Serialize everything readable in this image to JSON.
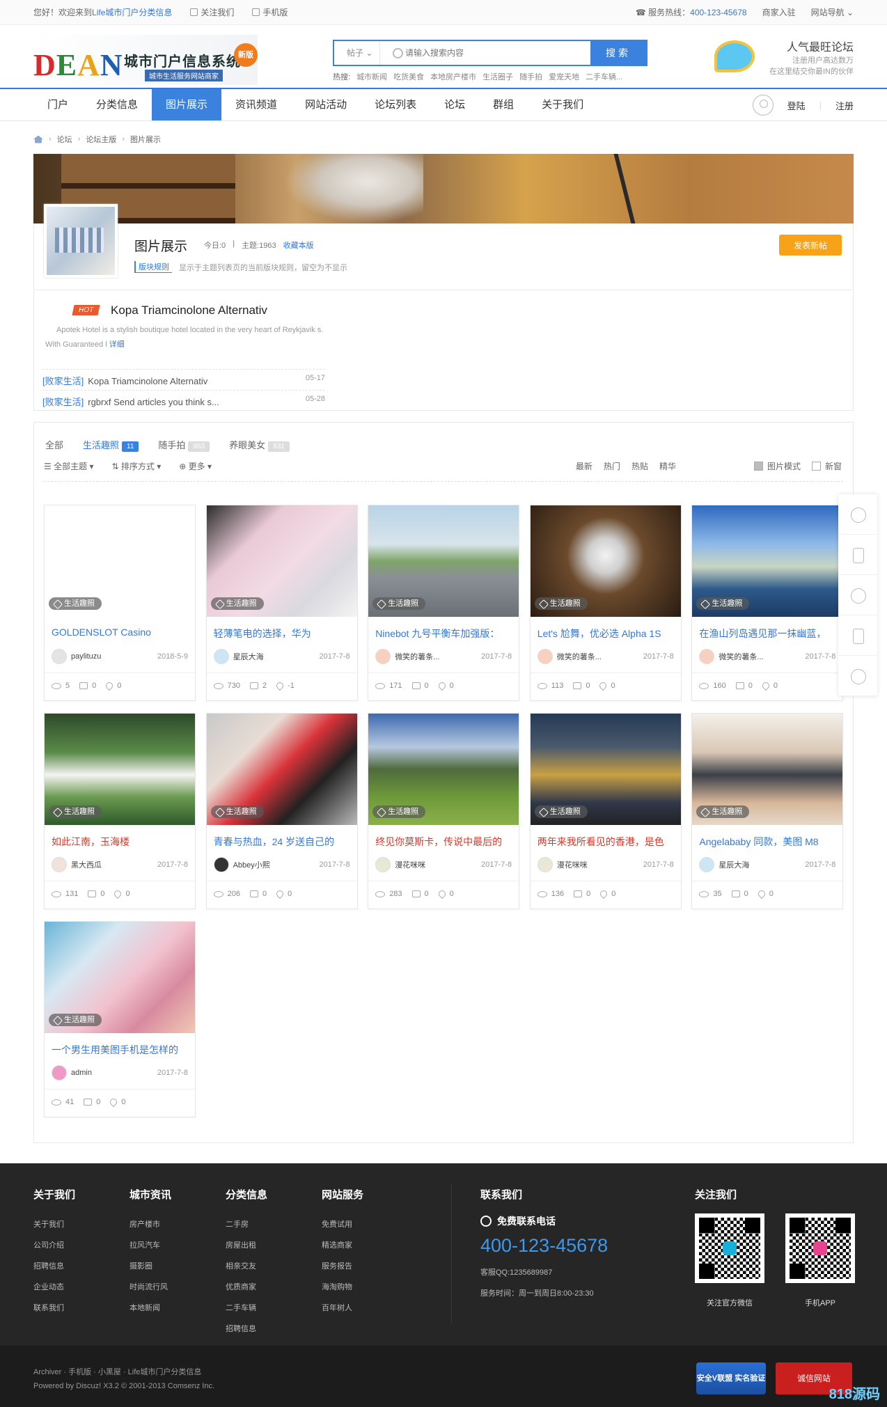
{
  "topbar": {
    "welcome_prefix": "您好！欢迎来到",
    "welcome_site": "Life城市门户分类信息",
    "follow": "关注我们",
    "mobile": "手机版",
    "hotline_label": "服务热线：",
    "hotline": "400-123-45678",
    "merchant": "商家入驻",
    "site_nav": "网站导航"
  },
  "logo": {
    "letters": [
      "D",
      "E",
      "A",
      "N"
    ],
    "title": "城市门户信息系统",
    "subtitle": "城市生活服务网站商家",
    "badge": "新版"
  },
  "search": {
    "scope": "帖子",
    "placeholder": "请输入搜索内容",
    "button": "搜索",
    "hot_label": "热搜:",
    "hot_words": [
      "城市新闻",
      "吃货美食",
      "本地房产楼市",
      "生活圈子",
      "随手拍",
      "爱宠天地",
      "二手车辆..."
    ]
  },
  "promo": {
    "title": "人气最旺论坛",
    "line1": "注册用户高达数万",
    "line2": "在这里结交你最IN的伙伴"
  },
  "nav": {
    "items": [
      "门户",
      "分类信息",
      "图片展示",
      "资讯频道",
      "网站活动",
      "论坛列表",
      "论坛",
      "群组",
      "关于我们"
    ],
    "active": 2,
    "login": "登陆",
    "register": "注册"
  },
  "breadcrumb": [
    "论坛",
    "论坛主版",
    "图片展示"
  ],
  "forum": {
    "title": "图片展示",
    "today": "今日:0",
    "topics": "主题:1963",
    "favorite": "收藏本版",
    "rule_tag": "版块规则",
    "rule_text": "显示于主题列表页的当前版块规则，留空为不显示",
    "post_btn": "发表新帖"
  },
  "announce": {
    "hot": "HOT",
    "title": "Kopa Triamcinolone Alternativ",
    "desc": "Apotek Hotel is a stylish boutique hotel located in the very heart of Reykjavik s. With Guaranteed l",
    "more": "详细",
    "lines": [
      {
        "cat": "[败家生活]",
        "text": "Kopa Triamcinolone Alternativ",
        "date": "05-17"
      },
      {
        "cat": "[败家生活]",
        "text": "rgbrxf Send articles you think s...",
        "date": "05-28"
      }
    ]
  },
  "filter": {
    "cats": [
      {
        "label": "全部",
        "count": ""
      },
      {
        "label": "生活趣照",
        "count": "11"
      },
      {
        "label": "随手拍",
        "count": "963"
      },
      {
        "label": "养眼美女",
        "count": "831"
      }
    ],
    "all_topics": "全部主题",
    "sort": "排序方式",
    "more": "更多",
    "orders": [
      "最新",
      "热门",
      "热贴",
      "精华"
    ],
    "pic_mode": "图片模式",
    "new_window": "新窗"
  },
  "colors": {
    "accent": "#3a82dd",
    "orange": "#f6a31a",
    "footer": "#262626"
  },
  "cards": [
    {
      "tag": "生活趣照",
      "title": "GOLDENSLOT Casino",
      "author": "paylituzu",
      "date": "2018-5-9",
      "views": "5",
      "replies": "0",
      "likes": "0",
      "red": false
    },
    {
      "tag": "生活趣照",
      "title": "轻薄笔电的选择，华为",
      "author": "星辰大海",
      "date": "2017-7-8",
      "views": "730",
      "replies": "2",
      "likes": "-1",
      "red": false
    },
    {
      "tag": "生活趣照",
      "title": "Ninebot 九号平衡车加强版：",
      "author": "微笑的薯条...",
      "date": "2017-7-8",
      "views": "171",
      "replies": "0",
      "likes": "0",
      "red": false
    },
    {
      "tag": "生活趣照",
      "title": "Let's 尬舞，优必选 Alpha 1S",
      "author": "微笑的薯条...",
      "date": "2017-7-8",
      "views": "113",
      "replies": "0",
      "likes": "0",
      "red": false
    },
    {
      "tag": "生活趣照",
      "title": "在渔山列岛遇见那一抹幽蓝，",
      "author": "微笑的薯条...",
      "date": "2017-7-8",
      "views": "160",
      "replies": "0",
      "likes": "0",
      "red": false
    },
    {
      "tag": "生活趣照",
      "title": "如此江南，玉海楼",
      "author": "黑大西瓜",
      "date": "2017-7-8",
      "views": "131",
      "replies": "0",
      "likes": "0",
      "red": true
    },
    {
      "tag": "生活趣照",
      "title": "青春与热血，24 岁送自己的",
      "author": "Abbey小熙",
      "date": "2017-7-8",
      "views": "206",
      "replies": "0",
      "likes": "0",
      "red": false
    },
    {
      "tag": "生活趣照",
      "title": "终见你莫斯卡，传说中最后的",
      "author": "漫花咪咪",
      "date": "2017-7-8",
      "views": "283",
      "replies": "0",
      "likes": "0",
      "red": true
    },
    {
      "tag": "生活趣照",
      "title": "两年来我所看见的香港，是色",
      "author": "漫花咪咪",
      "date": "2017-7-8",
      "views": "136",
      "replies": "0",
      "likes": "0",
      "red": true
    },
    {
      "tag": "生活趣照",
      "title": "Angelababy 同款，美图 M8",
      "author": "星辰大海",
      "date": "2017-7-8",
      "views": "35",
      "replies": "0",
      "likes": "0",
      "red": false
    },
    {
      "tag": "生活趣照",
      "title": "一个男生用美图手机是怎样的",
      "author": "admin",
      "date": "2017-7-8",
      "views": "41",
      "replies": "0",
      "likes": "0",
      "red": false
    }
  ],
  "footer": {
    "cols": [
      {
        "title": "关于我们",
        "items": [
          "关于我们",
          "公司介绍",
          "招聘信息",
          "企业动态",
          "联系我们"
        ]
      },
      {
        "title": "城市资讯",
        "items": [
          "房产楼市",
          "拉风汽车",
          "摄影圈",
          "时尚流行风",
          "本地新闻"
        ]
      },
      {
        "title": "分类信息",
        "items": [
          "二手房",
          "房屋出租",
          "相亲交友",
          "优质商家",
          "二手车辆",
          "招聘信息"
        ]
      },
      {
        "title": "网站服务",
        "items": [
          "免费试用",
          "精选商家",
          "服务报告",
          "海淘购物",
          "百年树人"
        ]
      }
    ],
    "contact_title": "联系我们",
    "free_call": "免费联系电话",
    "phone": "400-123-45678",
    "qq": "客服QQ:1235689987",
    "hours": "服务时间：周一到周日8:00-23:30",
    "follow_title": "关注我们",
    "qr1": "关注官方微信",
    "qr2": "手机APP"
  },
  "bottom": {
    "line1": "Archiver · 手机版 · 小黑屋 · Life城市门户分类信息",
    "line2": "Powered by Discuz! X3.2  © 2001-2013 Comsenz Inc.",
    "badge1": "安全V联盟 实名验证",
    "badge2": "诚信网站",
    "watermark": "818源码"
  }
}
